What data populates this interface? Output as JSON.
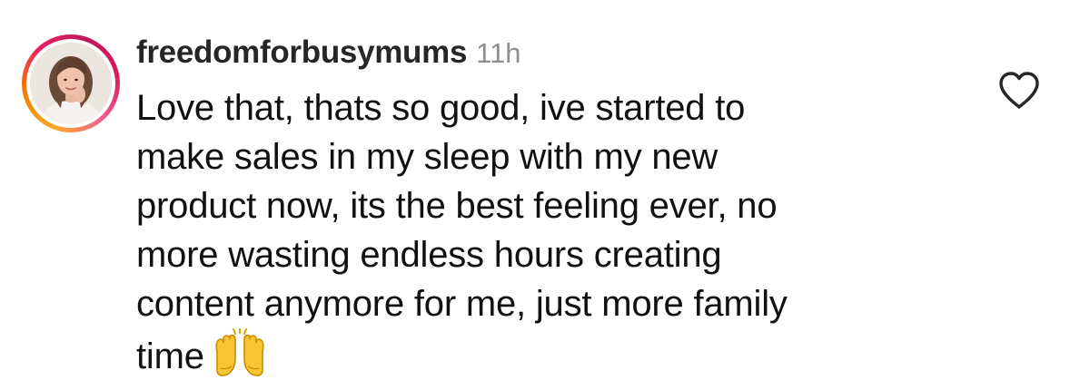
{
  "comment": {
    "username": "freedomforbusymums",
    "timestamp": "11h",
    "text_lines": [
      "Love that, thats so good, ive started to",
      "make sales in my sleep with my new",
      "product now, its the best feeling ever, no",
      "more wasting endless hours creating",
      "content anymore for me, just more family",
      "time"
    ],
    "emoji": "raising-hands-emoji",
    "avatar": "profile-photo",
    "like_icon": "heart-outline-icon"
  },
  "colors": {
    "username": "#262626",
    "timestamp": "#8e8e8e",
    "text": "#111111",
    "heart": "#262626",
    "story_ring_start": "#f9a825",
    "story_ring_end": "#d81b60"
  }
}
